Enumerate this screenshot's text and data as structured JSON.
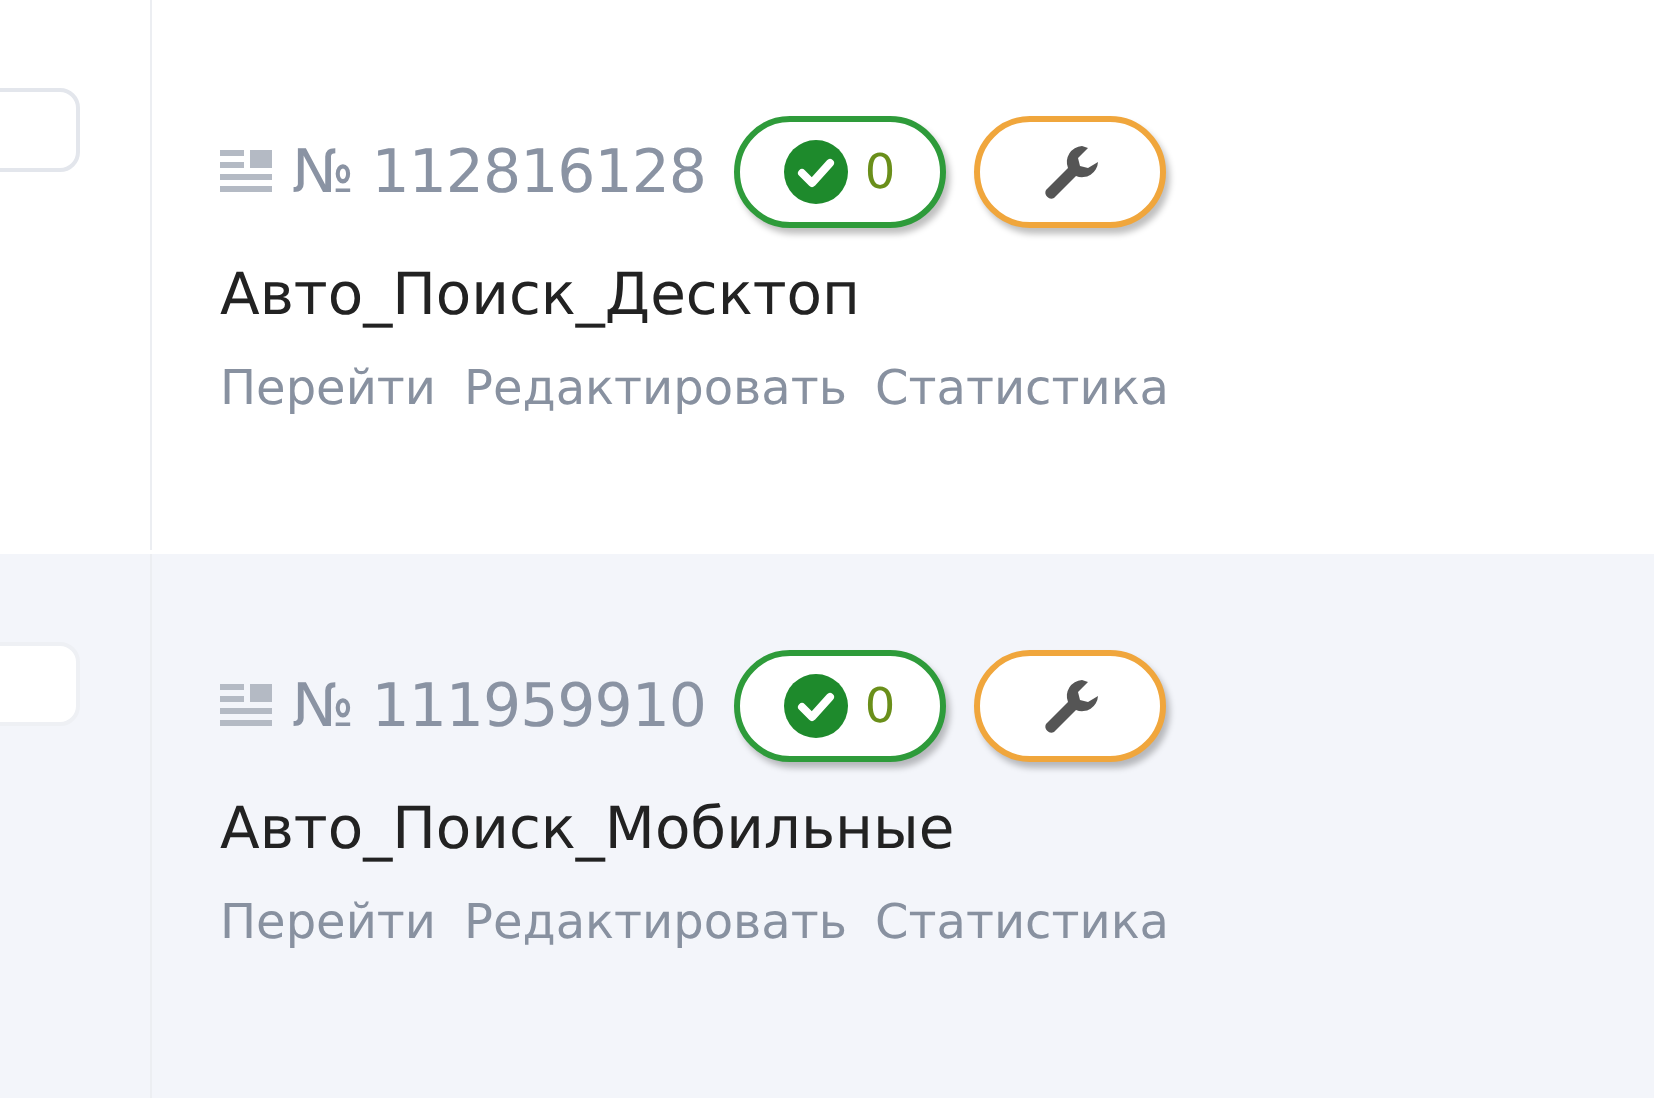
{
  "campaigns": [
    {
      "checked": false,
      "highlighted": false,
      "number": "№ 112816128",
      "approved_count": "0",
      "title": "Авто_Поиск_Десктоп",
      "links": [
        "Перейти",
        "Редактировать",
        "Статистика"
      ]
    },
    {
      "checked": false,
      "highlighted": true,
      "number": "№ 111959910",
      "approved_count": "0",
      "title": "Авто_Поиск_Мобильные",
      "links": [
        "Перейти",
        "Редактировать",
        "Статистика"
      ]
    }
  ]
}
